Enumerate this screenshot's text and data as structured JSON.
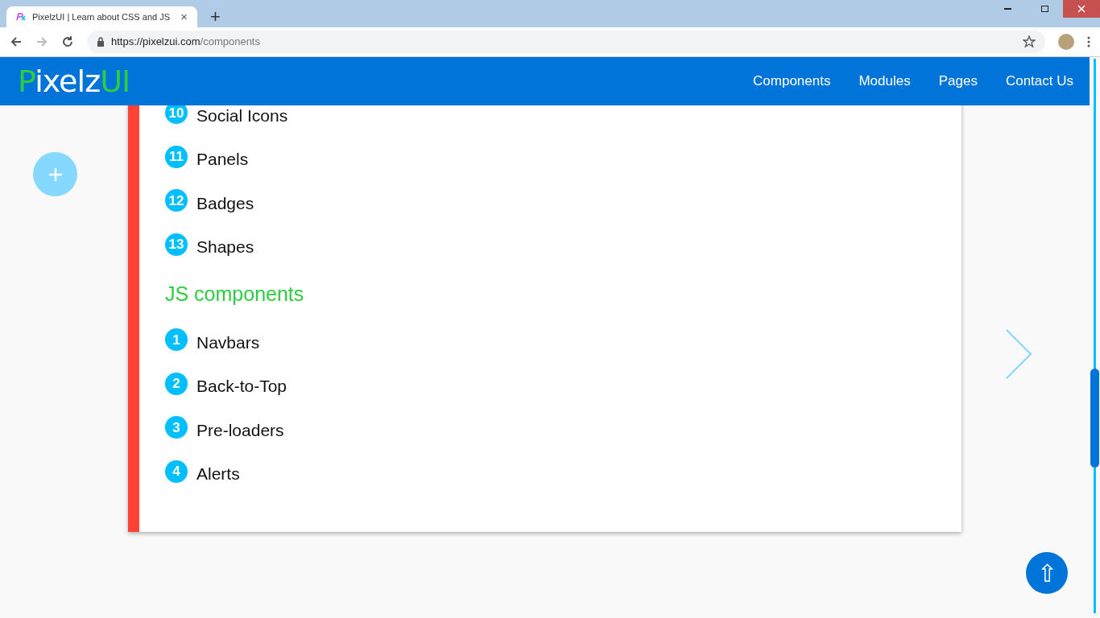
{
  "browser": {
    "tab_title": "PixelzUI | Learn about CSS and JS",
    "tab_close": "×",
    "new_tab": "+",
    "url_host": "https://pixelzui.com",
    "url_path": "/components"
  },
  "navbar": {
    "logo_main": "Pixelz",
    "logo_accent": "UI",
    "links": [
      {
        "label": "Components"
      },
      {
        "label": "Modules"
      },
      {
        "label": "Pages"
      },
      {
        "label": "Contact Us"
      }
    ]
  },
  "content": [
    {
      "kind": "item",
      "number": "10",
      "label": "Social Icons"
    },
    {
      "kind": "item",
      "number": "11",
      "label": "Panels"
    },
    {
      "kind": "item",
      "number": "12",
      "label": "Badges"
    },
    {
      "kind": "item",
      "number": "13",
      "label": "Shapes"
    },
    {
      "kind": "heading",
      "label": "JS components"
    },
    {
      "kind": "item",
      "number": "1",
      "label": "Navbars"
    },
    {
      "kind": "item",
      "number": "2",
      "label": "Back-to-Top"
    },
    {
      "kind": "item",
      "number": "3",
      "label": "Pre-loaders"
    },
    {
      "kind": "item",
      "number": "4",
      "label": "Alerts"
    }
  ],
  "back_to_top": "⇧"
}
